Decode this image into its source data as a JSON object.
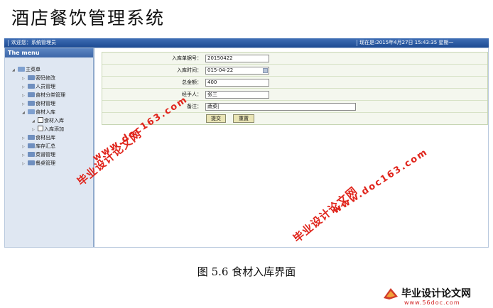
{
  "app": {
    "title": "酒店餐饮管理系统"
  },
  "topbar": {
    "welcome": "欢迎您：系统管理员",
    "datetime": "现在是:2015年4月27日 15:43:35 星期一"
  },
  "sidebar": {
    "header": "The menu",
    "root": "主菜单",
    "items": [
      {
        "label": "密码修改"
      },
      {
        "label": "人员管理"
      },
      {
        "label": "食材分类管理"
      },
      {
        "label": "食材管理"
      },
      {
        "label": "食材入库",
        "children": [
          {
            "label": "食材入库"
          },
          {
            "label": "入库添加"
          }
        ]
      },
      {
        "label": "食材出库"
      },
      {
        "label": "库存汇总"
      },
      {
        "label": "菜谱管理"
      },
      {
        "label": "餐桌管理"
      }
    ]
  },
  "form": {
    "fields": [
      {
        "label": "入库单据号：",
        "value": "20150422"
      },
      {
        "label": "入库时间：",
        "value": "015-04-22"
      },
      {
        "label": "总金额：",
        "value": "400"
      },
      {
        "label": "经手人：",
        "value": "张三"
      },
      {
        "label": "备注：",
        "value": "蔬菜|"
      }
    ],
    "submit_label": "提交",
    "reset_label": "重置"
  },
  "watermarks": {
    "site": "毕业设计论文网",
    "url": "www.doc163.com"
  },
  "caption": "图 5.6  食材入库界面",
  "brand": {
    "name": "毕业设计论文网",
    "url": "www.56doc.com"
  },
  "colors": {
    "topbar": "#1c4a92",
    "watermark": "#e0241b",
    "form_bg": "#f4f7ee",
    "button": "#e9e4b4"
  }
}
